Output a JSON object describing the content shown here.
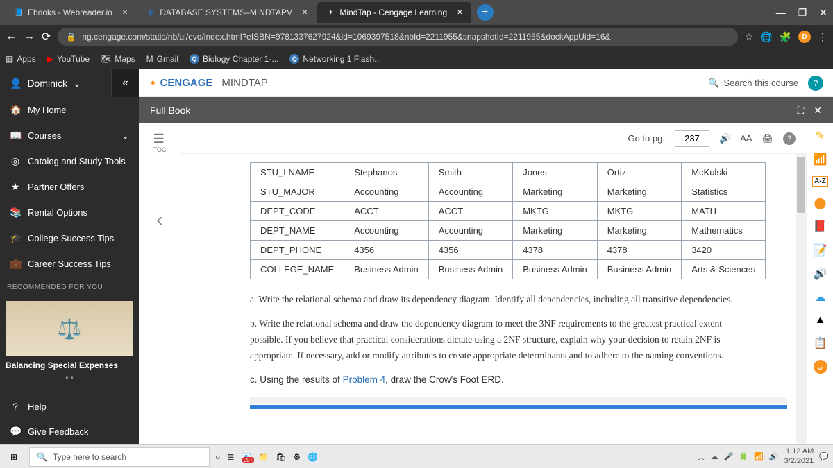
{
  "browser": {
    "tabs": [
      {
        "label": "Ebooks - Webreader.io",
        "active": false
      },
      {
        "label": "DATABASE SYSTEMS–MINDTAPV",
        "active": false,
        "prefix": "b"
      },
      {
        "label": "MindTap - Cengage Learning",
        "active": true
      }
    ],
    "url": "ng.cengage.com/static/nb/ui/evo/index.html?eISBN=9781337627924&id=1069397518&nbId=2211955&snapshotId=2211955&dockAppUid=16&",
    "bookmarks": [
      "Apps",
      "YouTube",
      "Maps",
      "Gmail",
      "Biology Chapter 1-...",
      "Networking 1 Flash..."
    ]
  },
  "sidebar": {
    "user": "Dominick",
    "items": [
      "My Home",
      "Courses",
      "Catalog and Study Tools",
      "Partner Offers",
      "Rental Options",
      "College Success Tips",
      "Career Success Tips"
    ],
    "rec_label": "RECOMMENDED FOR YOU",
    "rec_title": "Balancing Special Expenses",
    "help": "Help",
    "feedback": "Give Feedback"
  },
  "header": {
    "brand1": "CENGAGE",
    "brand2": "MINDTAP",
    "search_placeholder": "Search this course",
    "subbar_title": "Full Book"
  },
  "reader": {
    "goto_label": "Go to pg.",
    "page": "237",
    "font_label": "AA",
    "table": {
      "rows": [
        "STU_LNAME",
        "STU_MAJOR",
        "DEPT_CODE",
        "DEPT_NAME",
        "DEPT_PHONE",
        "COLLEGE_NAME"
      ],
      "cols": [
        [
          "Stephanos",
          "Accounting",
          "ACCT",
          "Accounting",
          "4356",
          "Business Admin"
        ],
        [
          "Smith",
          "Accounting",
          "ACCT",
          "Accounting",
          "4356",
          "Business Admin"
        ],
        [
          "Jones",
          "Marketing",
          "MKTG",
          "Marketing",
          "4378",
          "Business Admin"
        ],
        [
          "Ortiz",
          "Marketing",
          "MKTG",
          "Marketing",
          "4378",
          "Business Admin"
        ],
        [
          "McKulski",
          "Statistics",
          "MATH",
          "Mathematics",
          "3420",
          "Arts & Sciences"
        ]
      ]
    },
    "qa": "a. Write the relational schema and draw its dependency diagram. Identify all dependencies, including all transitive dependencies.",
    "qb": "b. Write the relational schema and draw the dependency diagram to meet the 3NF requirements to the greatest practical extent possible. If you believe that practical considerations dictate using a 2NF structure, explain why your decision to retain 2NF is appropriate. If necessary, add or modify attributes to create appropriate determinants and to adhere to the naming conventions.",
    "qc_pre": "c. Using the results of ",
    "qc_link": "Problem 4",
    "qc_post": ", draw the Crow's Foot ERD."
  },
  "taskbar": {
    "search": "Type here to search",
    "time": "1:12 AM",
    "date": "3/2/2021",
    "badge": "99+"
  }
}
